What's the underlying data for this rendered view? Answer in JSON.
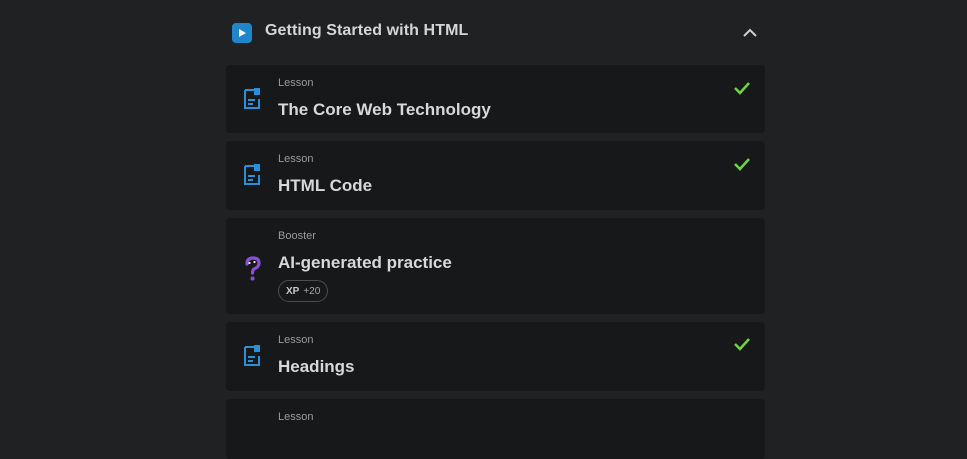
{
  "section": {
    "title": "Getting Started with HTML",
    "play_icon": "play-icon",
    "collapse_icon": "chevron-up-icon"
  },
  "items": [
    {
      "type": "Lesson",
      "title": "The Core Web Technology",
      "icon": "lesson-doc-icon",
      "completed": true
    },
    {
      "type": "Lesson",
      "title": "HTML Code",
      "icon": "lesson-doc-icon",
      "completed": true
    },
    {
      "type": "Booster",
      "title": "AI-generated practice",
      "icon": "question-mark-icon",
      "completed": false,
      "xp_label": "XP",
      "xp_value": "+20"
    },
    {
      "type": "Lesson",
      "title": "Headings",
      "icon": "lesson-doc-icon",
      "completed": true
    },
    {
      "type": "Lesson",
      "title": "",
      "icon": "lesson-doc-icon",
      "completed": false
    }
  ],
  "colors": {
    "background": "#202122",
    "card": "#17181a",
    "accent_blue": "#1f86c9",
    "check_green": "#6fd34a",
    "booster_purple": "#8a4fd6"
  }
}
